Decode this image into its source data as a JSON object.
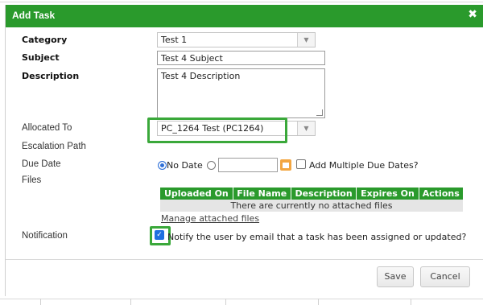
{
  "dialog": {
    "title": "Add Task",
    "close_glyph": "✖"
  },
  "form": {
    "category": {
      "label": "Category",
      "value": "Test 1"
    },
    "subject": {
      "label": "Subject",
      "value": "Test 4 Subject"
    },
    "description": {
      "label": "Description",
      "value": "Test 4 Description"
    },
    "allocated_to": {
      "label": "Allocated To",
      "value": "PC_1264 Test (PC1264)"
    },
    "escalation_path": {
      "label": "Escalation Path"
    },
    "due_date": {
      "label": "Due Date",
      "no_date_option": "No Date",
      "date_value": "",
      "add_multiple_label": "Add Multiple Due Dates?"
    },
    "files": {
      "label": "Files",
      "columns": [
        "Uploaded On",
        "File Name",
        "Description",
        "Expires On",
        "Actions"
      ],
      "empty_message": "There are currently no attached files",
      "manage_link": "Manage attached files"
    },
    "notification": {
      "label": "Notification",
      "checkbox_label": "Notify the user by email that a task has been assigned or updated?",
      "checked": true
    }
  },
  "footer": {
    "save_label": "Save",
    "cancel_label": "Cancel"
  },
  "icons": {
    "dropdown_arrow": "▼",
    "checkmark": "✓"
  },
  "colors": {
    "header_green": "#2a9a2c",
    "highlight_green": "#3aa83a",
    "calendar_orange": "#f3a641",
    "radio_blue": "#2e6fd8"
  }
}
